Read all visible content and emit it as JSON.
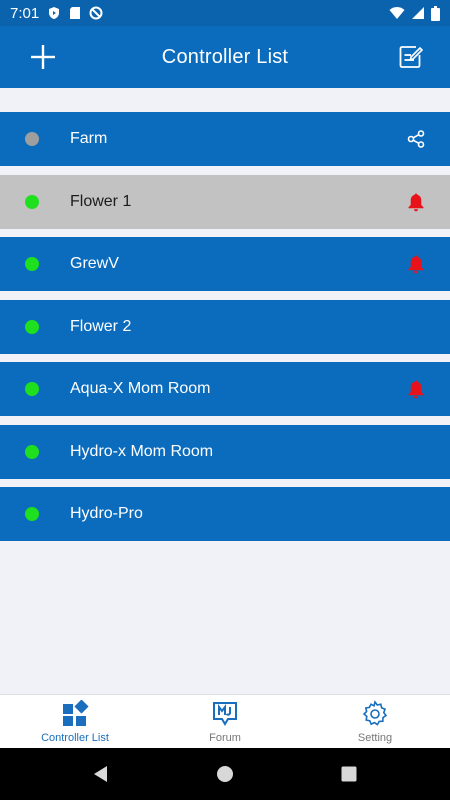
{
  "status_bar": {
    "time": "7:01",
    "icons": [
      "shield-play-icon",
      "sd-card-icon",
      "no-disturb-icon",
      "wifi-icon",
      "signal-icon",
      "battery-icon"
    ]
  },
  "app_bar": {
    "title": "Controller List",
    "add_icon": "plus-icon",
    "edit_icon": "edit-note-icon"
  },
  "controllers": [
    {
      "name": "Farm",
      "status": "offline",
      "status_color": "#9e9e9e",
      "right_icon": "share-icon",
      "selected": false
    },
    {
      "name": "Flower 1",
      "status": "online",
      "status_color": "#1ee01e",
      "right_icon": "bell-icon",
      "selected": true
    },
    {
      "name": "GrewV",
      "status": "online",
      "status_color": "#1ee01e",
      "right_icon": "bell-icon",
      "selected": false
    },
    {
      "name": "Flower 2",
      "status": "online",
      "status_color": "#1ee01e",
      "right_icon": "",
      "selected": false
    },
    {
      "name": "Aqua-X Mom Room",
      "status": "online",
      "status_color": "#1ee01e",
      "right_icon": "bell-icon",
      "selected": false
    },
    {
      "name": "Hydro-x Mom Room",
      "status": "online",
      "status_color": "#1ee01e",
      "right_icon": "",
      "selected": false
    },
    {
      "name": "Hydro-Pro",
      "status": "online",
      "status_color": "#1ee01e",
      "right_icon": "",
      "selected": false
    }
  ],
  "bottom_nav": [
    {
      "label": "Controller List",
      "icon": "dashboard-icon",
      "active": true
    },
    {
      "label": "Forum",
      "icon": "forum-icon",
      "active": false
    },
    {
      "label": "Setting",
      "icon": "gear-icon",
      "active": false
    }
  ],
  "colors": {
    "primary": "#0b6cbd",
    "status_bar": "#0b63ad",
    "alert": "#e8131a",
    "online": "#1ee01e",
    "offline": "#9e9e9e",
    "selected_row": "#c2c2c2"
  }
}
